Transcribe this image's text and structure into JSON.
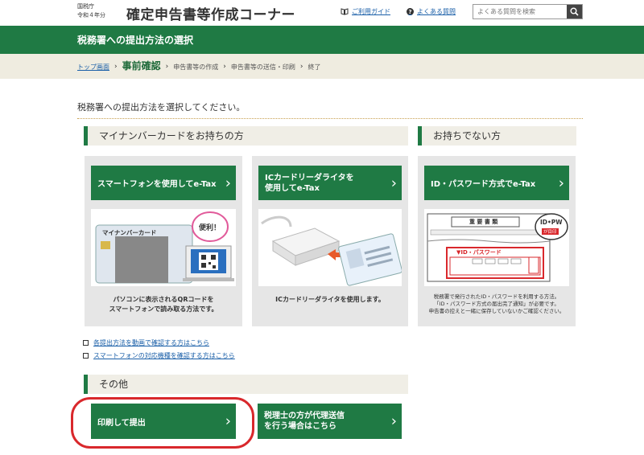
{
  "header": {
    "agency": "国税庁",
    "fiscal_year": "令和４年分",
    "title": "確定申告書等作成コーナー",
    "guide_label": "ご利用ガイド",
    "faq_label": "よくある質問",
    "search_placeholder": "よくある質問を検索"
  },
  "page_title": "税務署への提出方法の選択",
  "breadcrumb": {
    "home": "トップ画面",
    "current": "事前確認",
    "steps": [
      "申告書等の作成",
      "申告書等の送信・印刷",
      "終了"
    ]
  },
  "intro": "税務署への提出方法を選択してください。",
  "sections": {
    "mynumber": "マイナンバーカードをお持ちの方",
    "no_card": "お持ちでない方",
    "other": "その他"
  },
  "cards": {
    "smartphone": {
      "button": "スマートフォンを使用してe-Tax",
      "illus_card_label": "マイナンバーカード",
      "illus_bubble": "便利！",
      "desc_line1": "パソコンに表示されるQRコードを",
      "desc_line2": "スマートフォンで読み取る方法です。"
    },
    "ic_reader": {
      "button_line1": "ICカードリーダライタを",
      "button_line2": "使用してe-Tax",
      "desc": "ICカードリーダライタを使用します。"
    },
    "id_pw": {
      "button": "ID・パスワード方式でe-Tax",
      "illus_doc_title": "重 要 書 類",
      "illus_badge_top": "ID•PW",
      "illus_badge_bottom": "が目印",
      "illus_field": "▼ID・パスワード",
      "desc_line1": "税務署で発行されたID・パスワードを利用する方法。",
      "desc_line2": "「ID・パスワード方式の届出完了通知」が必要です。",
      "desc_line3": "申告書の控えと一緒に保存していないかご確認ください。"
    }
  },
  "links": [
    "各提出方法を動画で確認する方はこちら",
    "スマートフォンの対応機種を確認する方はこちら"
  ],
  "other_buttons": {
    "print": "印刷して提出",
    "tax_accountant_line1": "税理士の方が代理送信",
    "tax_accountant_line2": "を行う場合はこちら"
  },
  "colors": {
    "brand_green": "#1f7a44",
    "highlight_red": "#d9282c",
    "link_blue": "#1a5fa8"
  }
}
